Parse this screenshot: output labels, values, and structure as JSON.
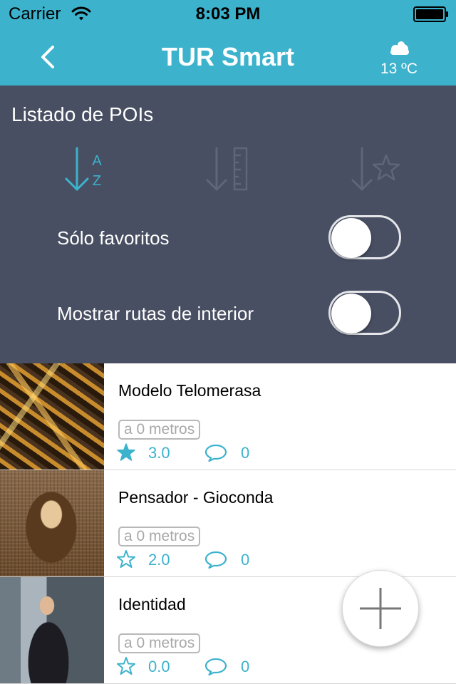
{
  "status_bar": {
    "carrier": "Carrier",
    "time": "8:03 PM"
  },
  "header": {
    "title": "TUR Smart",
    "back_icon": "chevron-left-icon",
    "weather_icon": "cloud-icon",
    "temperature": "13 ºC",
    "background_color": "#3cb2cc"
  },
  "panel": {
    "title": "Listado de POIs",
    "sort_options": [
      {
        "icon": "sort-alphabetical-icon",
        "glyph_a": "A",
        "glyph_z": "Z",
        "active": true
      },
      {
        "icon": "sort-distance-icon",
        "active": false
      },
      {
        "icon": "sort-rating-icon",
        "active": false
      }
    ],
    "toggles": [
      {
        "label": "Sólo favoritos",
        "on": false
      },
      {
        "label": "Mostrar rutas de interior",
        "on": false
      }
    ],
    "background_color": "#484f62",
    "accent_color": "#3cb2cc"
  },
  "pois": [
    {
      "name": "Modelo Telomerasa",
      "distance": "a 0 metros",
      "rating": "3.0",
      "rating_filled": true,
      "comments": "0"
    },
    {
      "name": "Pensador - Gioconda",
      "distance": "a 0 metros",
      "rating": "2.0",
      "rating_filled": false,
      "comments": "0"
    },
    {
      "name": "Identidad",
      "distance": "a 0 metros",
      "rating": "0.0",
      "rating_filled": false,
      "comments": "0"
    }
  ],
  "fab": {
    "icon": "plus-icon"
  }
}
